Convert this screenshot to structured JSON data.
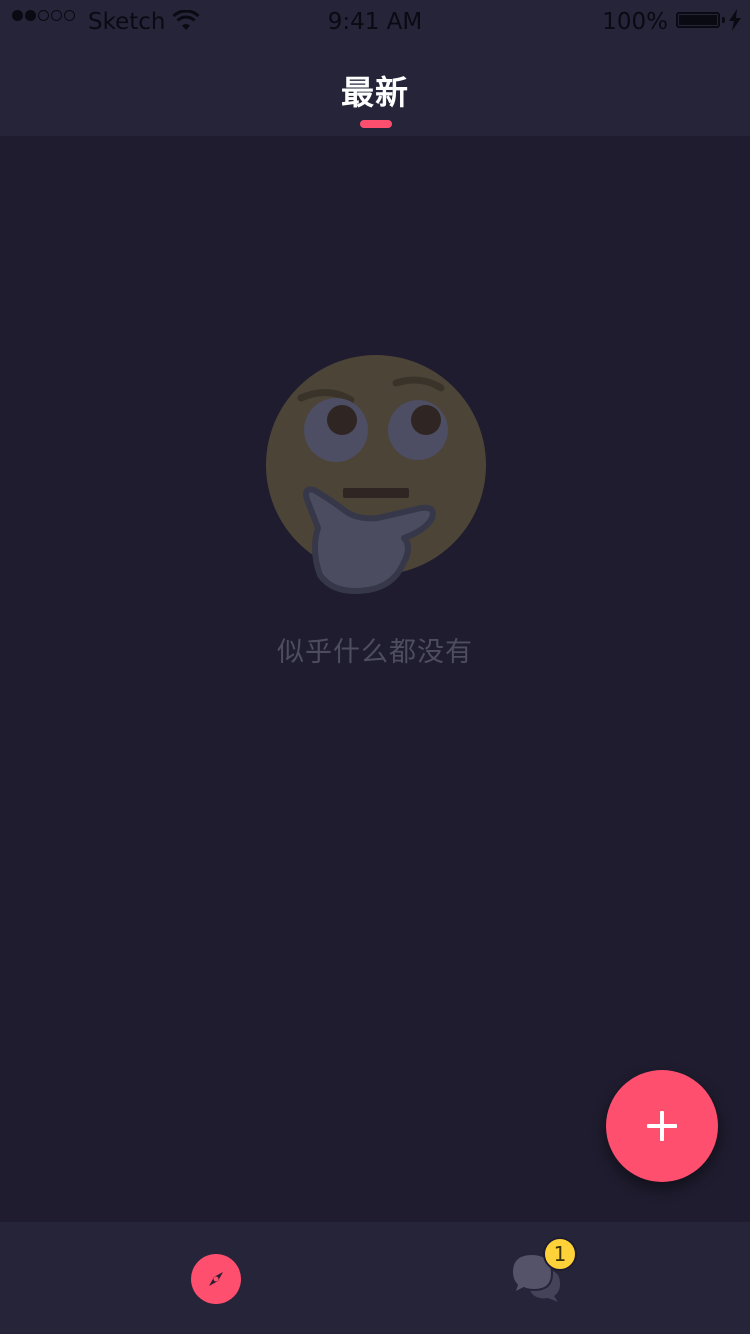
{
  "status_bar": {
    "carrier": "Sketch",
    "time": "9:41 AM",
    "battery": "100%"
  },
  "header": {
    "title": "最新"
  },
  "empty_state": {
    "icon": "thinking-face",
    "message": "似乎什么都没有"
  },
  "fab": {
    "icon": "plus-icon"
  },
  "tabbar": {
    "tabs": [
      {
        "icon": "compass-icon",
        "active": true
      },
      {
        "icon": "chat-bubbles-icon",
        "active": false,
        "badge": "1"
      }
    ]
  },
  "colors": {
    "background": "#1e1c2e",
    "header": "#252439",
    "accent": "#ff4f6f",
    "badge": "#ffd23a"
  }
}
